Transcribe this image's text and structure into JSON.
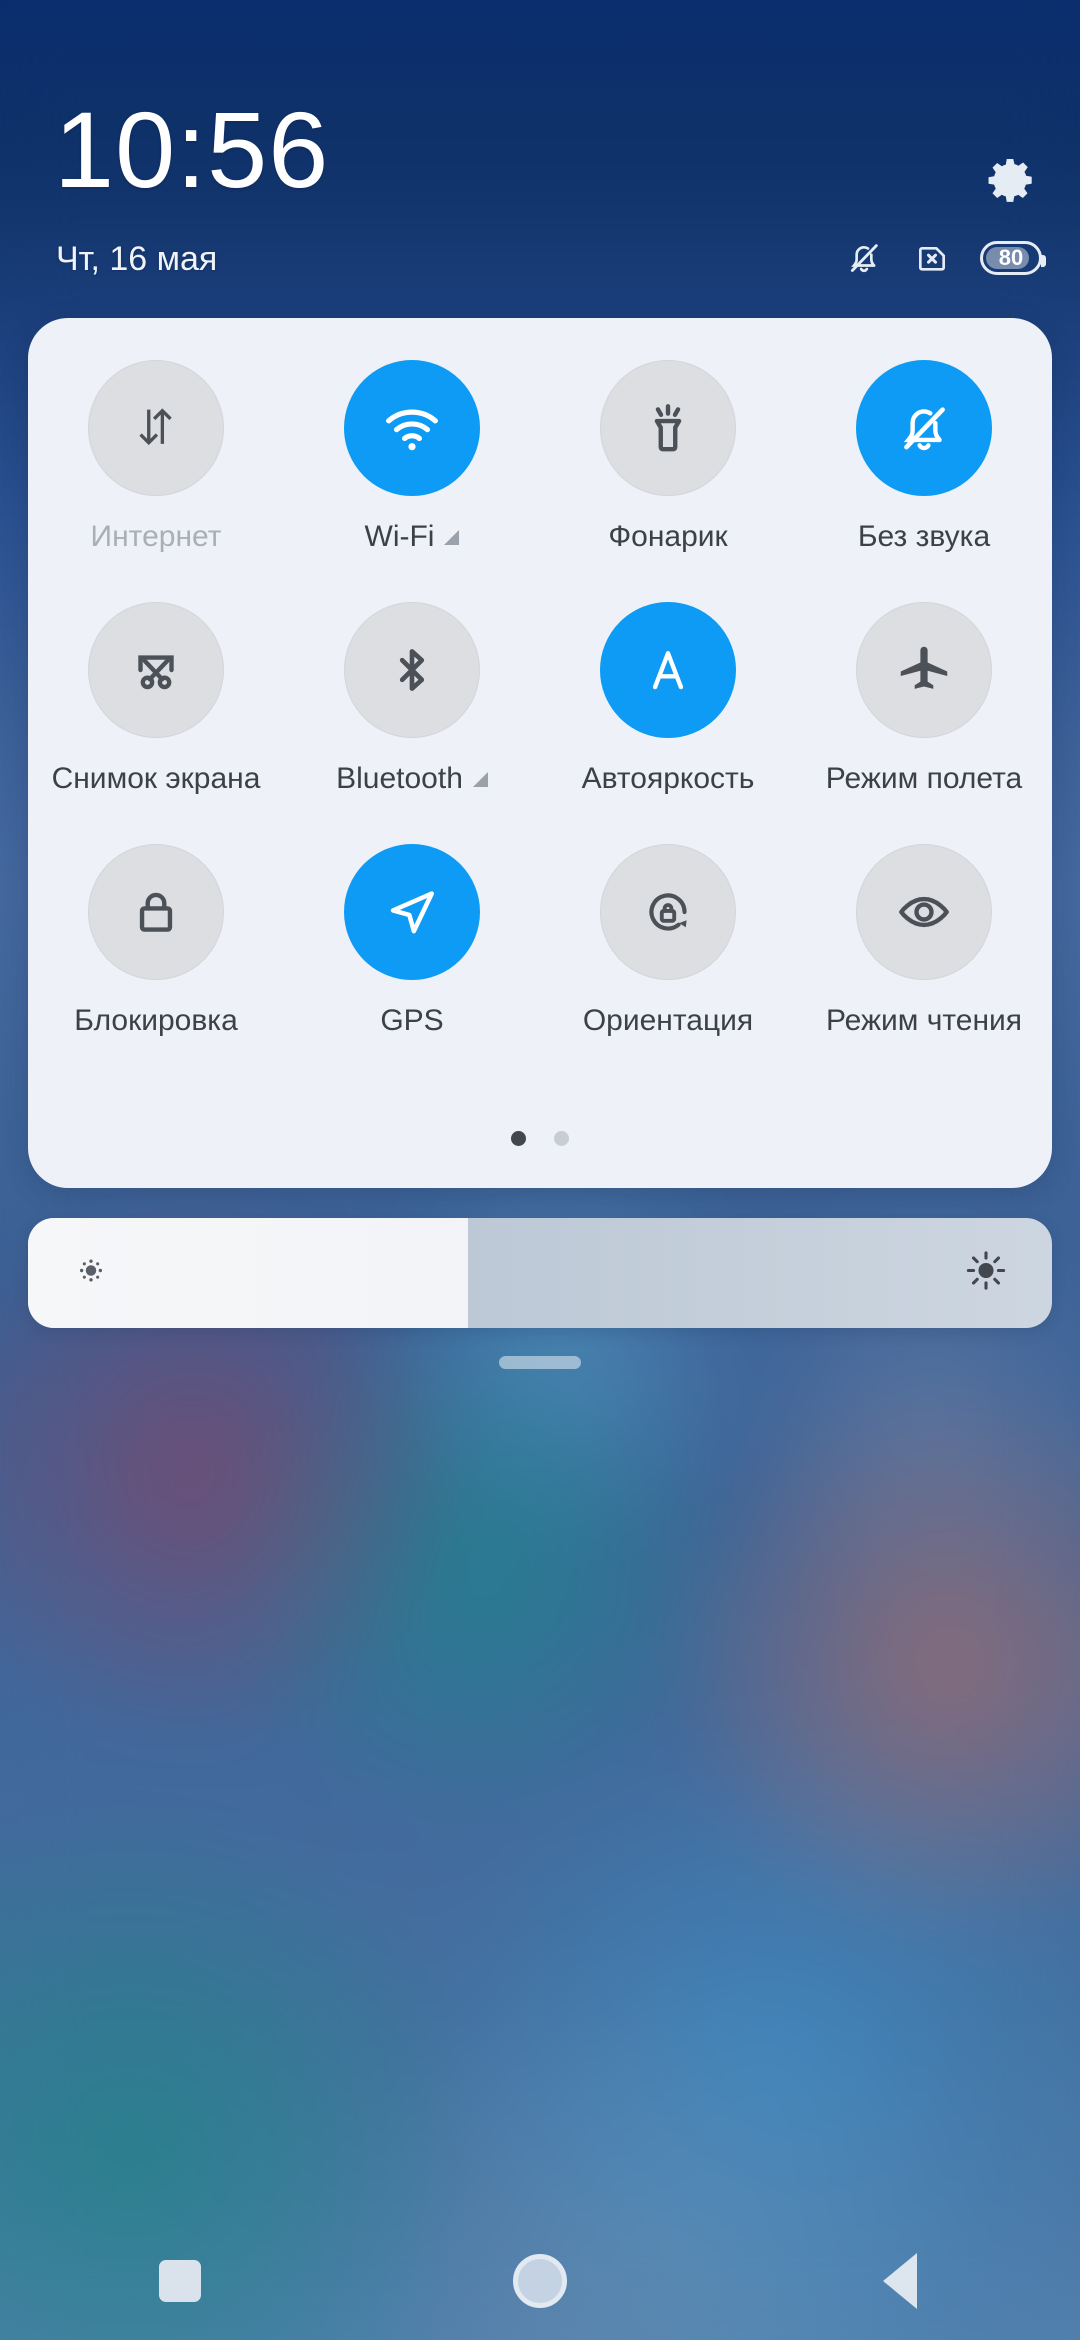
{
  "statusbar": {
    "time": "10:56",
    "date": "Чт, 16 мая",
    "settings_icon": "gear-icon",
    "icons": [
      {
        "name": "notifications-muted-icon",
        "label": "Без звука"
      },
      {
        "name": "sim-card-missing-icon",
        "label": "Нет SIM-карты"
      }
    ],
    "battery": {
      "percent": "80",
      "level": 80
    }
  },
  "control_center": {
    "tiles": [
      {
        "label": "Интернет",
        "icon": "data-transfer-icon",
        "active": false,
        "dimmed": true,
        "expandable": false
      },
      {
        "label": "Wi-Fi",
        "icon": "wifi-icon",
        "active": true,
        "dimmed": false,
        "expandable": true
      },
      {
        "label": "Фонарик",
        "icon": "flashlight-icon",
        "active": false,
        "dimmed": false,
        "expandable": false
      },
      {
        "label": "Без звука",
        "icon": "bell-muted-icon",
        "active": true,
        "dimmed": false,
        "expandable": false
      },
      {
        "label": "Снимок экрана",
        "icon": "screenshot-icon",
        "active": false,
        "dimmed": false,
        "expandable": false
      },
      {
        "label": "Bluetooth",
        "icon": "bluetooth-icon",
        "active": false,
        "dimmed": false,
        "expandable": true
      },
      {
        "label": "Автояркость",
        "icon": "auto-brightness-icon",
        "active": true,
        "dimmed": false,
        "expandable": false
      },
      {
        "label": "Режим полета",
        "icon": "airplane-icon",
        "active": false,
        "dimmed": false,
        "expandable": false
      },
      {
        "label": "Блокировка",
        "icon": "lock-icon",
        "active": false,
        "dimmed": false,
        "expandable": false
      },
      {
        "label": "GPS",
        "icon": "location-arrow-icon",
        "active": true,
        "dimmed": false,
        "expandable": false
      },
      {
        "label": "Ориентация",
        "icon": "rotation-lock-icon",
        "active": false,
        "dimmed": false,
        "expandable": false
      },
      {
        "label": "Режим чтения",
        "icon": "eye-icon",
        "active": false,
        "dimmed": false,
        "expandable": false
      }
    ],
    "pages": {
      "count": 2,
      "current": 1
    }
  },
  "brightness": {
    "value_percent": 43,
    "low_icon": "brightness-low-icon",
    "high_icon": "brightness-high-icon"
  },
  "drag_handle": {
    "name": "panel-drag-handle"
  },
  "navbar": {
    "buttons": [
      {
        "name": "recents-button",
        "icon": "square-icon"
      },
      {
        "name": "home-button",
        "icon": "circle-icon"
      },
      {
        "name": "back-button",
        "icon": "triangle-left-icon"
      }
    ]
  },
  "colors": {
    "accent": "#0d9bf5",
    "panel_bg": "#eef1f7",
    "tile_off": "#dcdee1",
    "label": "#3c4149",
    "label_dim": "#a9afb8"
  }
}
